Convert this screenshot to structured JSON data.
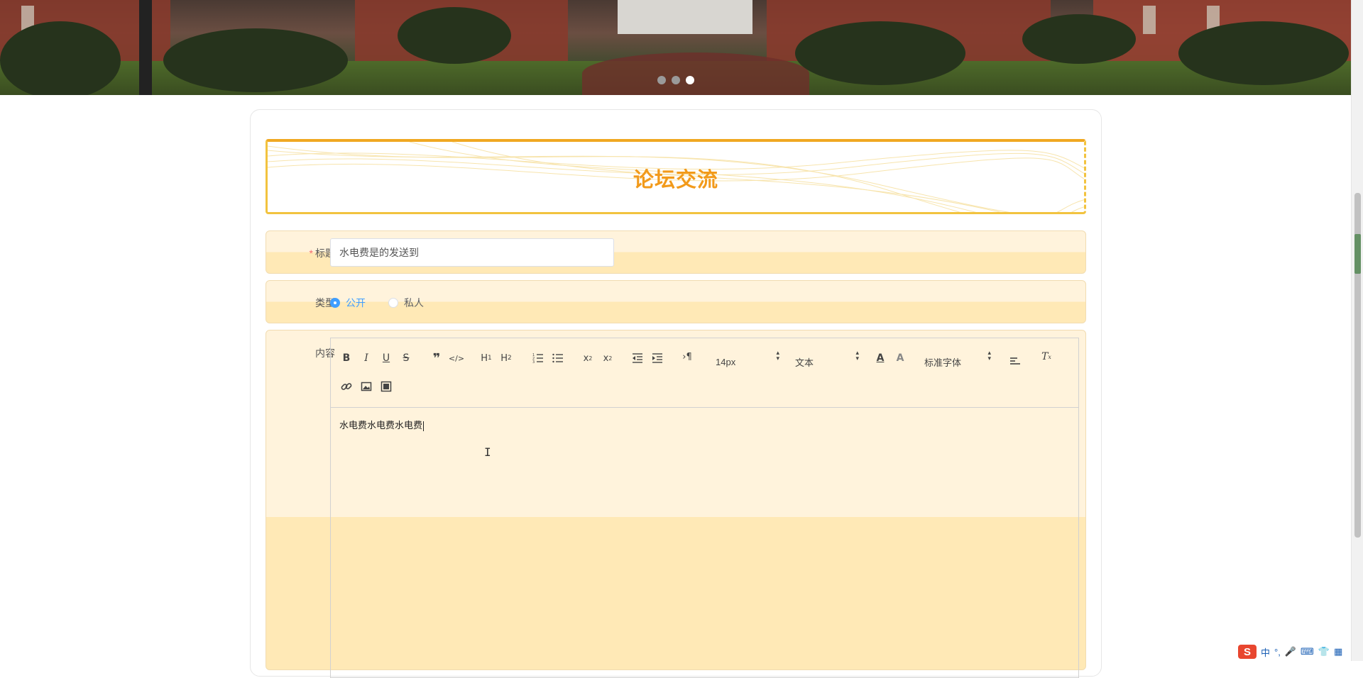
{
  "carousel": {
    "slides": 3,
    "active_slide": 3
  },
  "page_title": "论坛交流",
  "form": {
    "title_label": "标题",
    "title_required_mark": "*",
    "title_value": "水电费是的发送到",
    "type_label": "类型",
    "type_options": [
      "公开",
      "私人"
    ],
    "type_selected": "公开",
    "content_label": "内容",
    "editor": {
      "font_size": "14px",
      "header_select": "文本",
      "font_family": "标准字体",
      "content": "水电费水电费水电费"
    }
  },
  "ime": {
    "logo": "S",
    "lang": "中",
    "punct": "°,"
  },
  "colors": {
    "title_orange": "#f29a1a",
    "row_light": "#fff3dc",
    "row_dark": "#ffe9b6",
    "radio_blue": "#409eff"
  }
}
